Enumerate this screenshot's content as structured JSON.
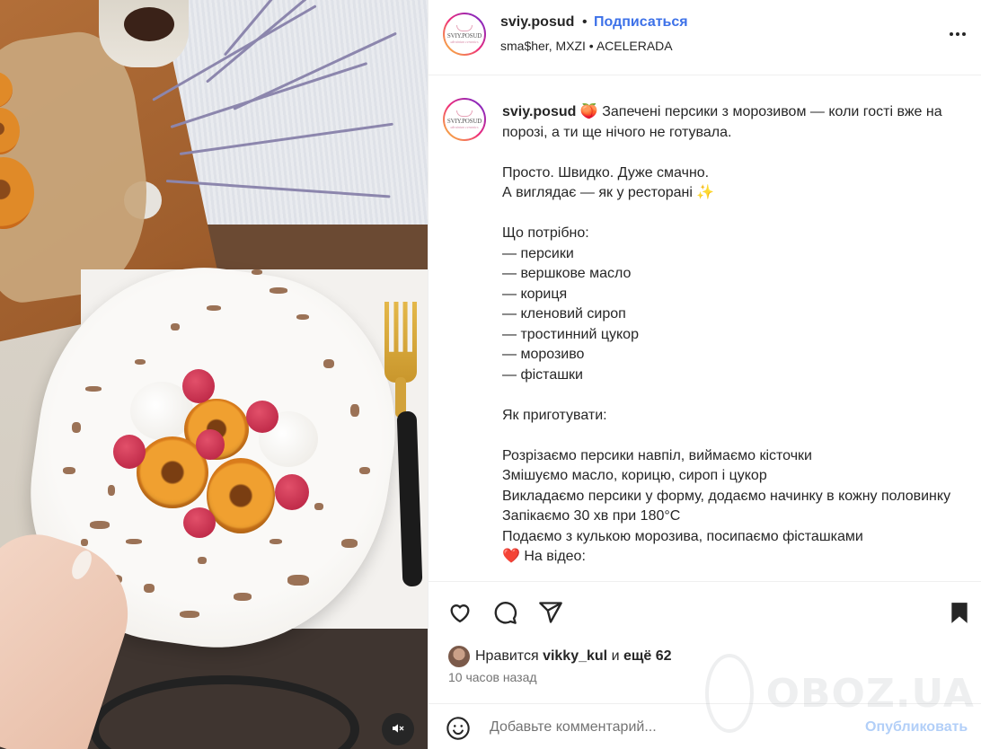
{
  "post": {
    "username": "sviy.posud",
    "separator": "•",
    "follow_label": "Подписаться",
    "audio": "sma$her, MXZI • ACELERADA",
    "avatar_brand": "SVIY.POSUD",
    "avatar_sub": "ukrainian ceramics"
  },
  "caption": {
    "username": "sviy.posud",
    "lines": [
      "🍑 Запечені персики з морозивом — коли гості вже на порозі, а ти ще нічого не готувала.",
      "",
      "Просто. Швидко. Дуже смачно.",
      "А виглядає — як у ресторані ✨",
      "",
      "Що потрібно:",
      "— персики",
      "— вершкове масло",
      "— кориця",
      "— кленовий сироп",
      "— тростинний цукор",
      "— морозиво",
      "— фісташки",
      "",
      "Як приготувати:",
      "",
      "Розрізаємо персики навпіл, виймаємо кісточки",
      "Змішуємо масло, корицю, сироп і цукор",
      "Викладаємо персики у форму, додаємо начинку в кожну половинку",
      "Запікаємо 30 хв при 180°C",
      "Подаємо з кулькою морозива, посипаємо фісташками",
      "❤️ На відео:"
    ]
  },
  "actions": {
    "likes_prefix": "Нравится",
    "liker": "vikky_kul",
    "likes_mid": "и",
    "likes_more": "ещё 62",
    "time": "10 часов назад"
  },
  "comment": {
    "placeholder": "Добавьте комментарий...",
    "publish_label": "Опубликовать"
  },
  "watermark": {
    "text": "OBOZ.UA"
  },
  "colors": {
    "link_blue": "#3d71e8",
    "publish_disabled": "#b2cff8",
    "secondary_text": "#737373"
  },
  "icons": [
    "volume-off-icon",
    "more-options-icon",
    "heart-icon",
    "comment-icon",
    "share-icon",
    "bookmark-icon",
    "emoji-icon"
  ]
}
